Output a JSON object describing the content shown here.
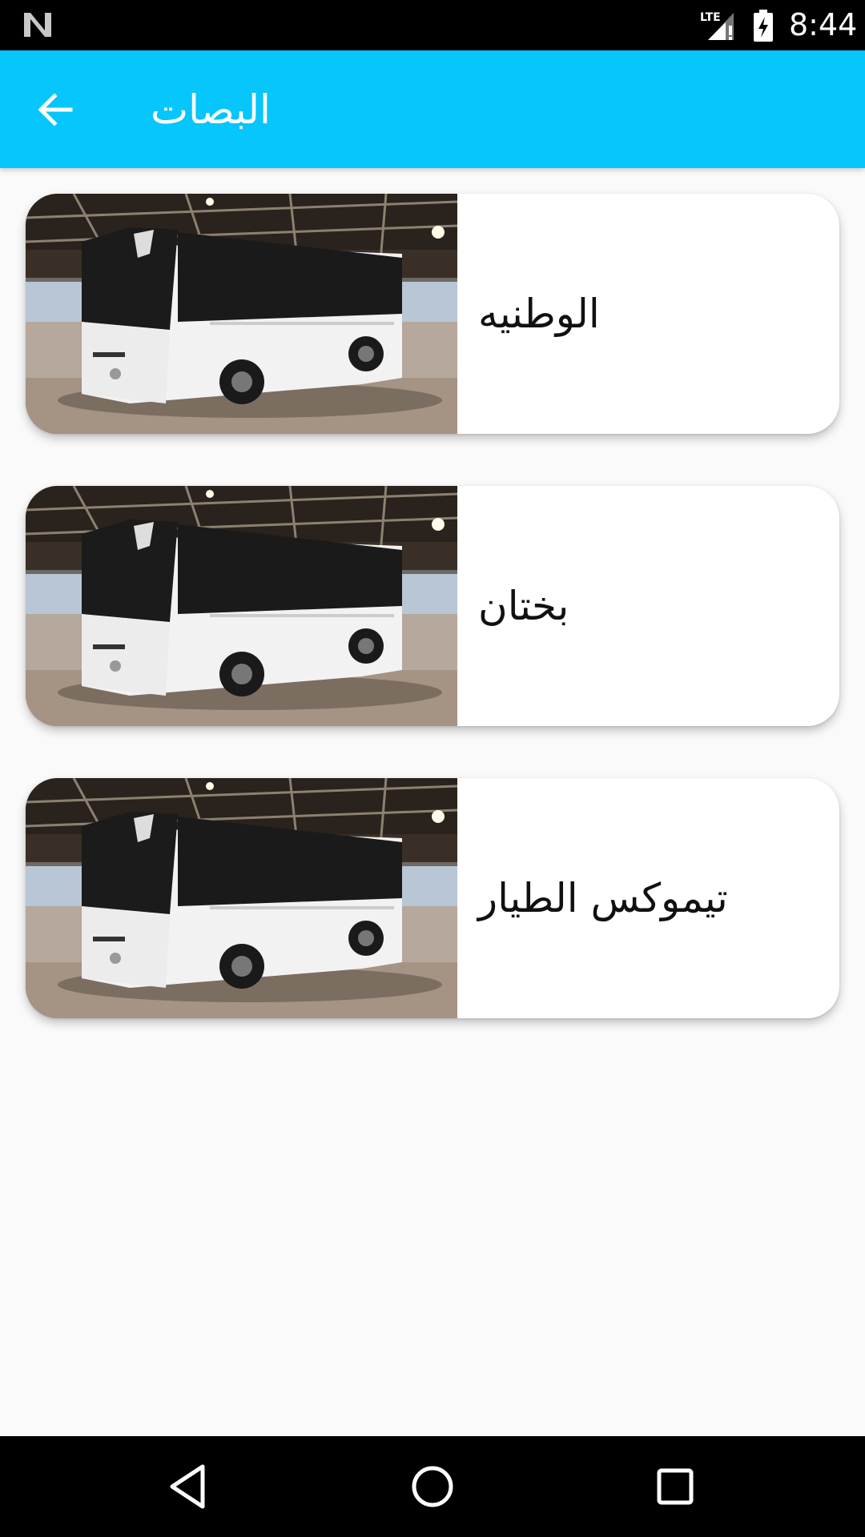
{
  "status_bar": {
    "time": "8:44",
    "network": "LTE",
    "icons": [
      "n-logo-icon",
      "lte-signal-icon",
      "battery-charging-icon"
    ]
  },
  "app_bar": {
    "title": "البصات",
    "back_icon": "arrow-back-icon",
    "color": "#06c6fb"
  },
  "items": [
    {
      "label": "الوطنيه",
      "image": "white-coach-bus"
    },
    {
      "label": "بختان",
      "image": "white-coach-bus"
    },
    {
      "label": "تيموكس الطيار",
      "image": "white-coach-bus"
    }
  ],
  "nav_bar": {
    "buttons": [
      "nav-back-icon",
      "nav-home-icon",
      "nav-recents-icon"
    ]
  }
}
